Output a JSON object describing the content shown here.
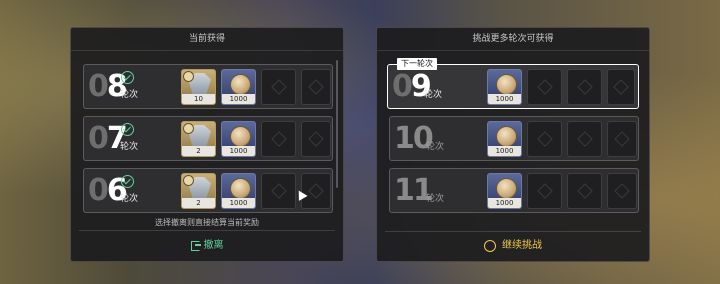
{
  "left_panel": {
    "title": "当前获得",
    "rows": [
      {
        "num_a": "0",
        "num_b": "8",
        "label": "轮次",
        "items": [
          {
            "type": "relic",
            "qty": "10"
          },
          {
            "type": "coin",
            "qty": "1000"
          }
        ]
      },
      {
        "num_a": "0",
        "num_b": "7",
        "label": "轮次",
        "items": [
          {
            "type": "relic",
            "qty": "2"
          },
          {
            "type": "coin",
            "qty": "1000"
          }
        ]
      },
      {
        "num_a": "0",
        "num_b": "6",
        "label": "轮次",
        "items": [
          {
            "type": "relic",
            "qty": "2"
          },
          {
            "type": "coin",
            "qty": "1000"
          }
        ]
      }
    ],
    "hint": "选择撤离则直接结算当前奖励",
    "action_label": "撤离"
  },
  "right_panel": {
    "title": "挑战更多轮次可获得",
    "next_tag": "下一轮次",
    "rows": [
      {
        "num_a": "0",
        "num_b": "9",
        "label": "轮次",
        "items": [
          {
            "type": "coin",
            "qty": "1000"
          }
        ]
      },
      {
        "num_a": "1",
        "num_b": "0",
        "label": "轮次",
        "items": [
          {
            "type": "coin",
            "qty": "1000"
          }
        ]
      },
      {
        "num_a": "1",
        "num_b": "1",
        "label": "轮次",
        "items": [
          {
            "type": "coin",
            "qty": "1000"
          }
        ]
      }
    ],
    "action_label": "继续挑战"
  },
  "colors": {
    "accent_green": "#5ed39b",
    "accent_gold": "#f2c84b"
  }
}
